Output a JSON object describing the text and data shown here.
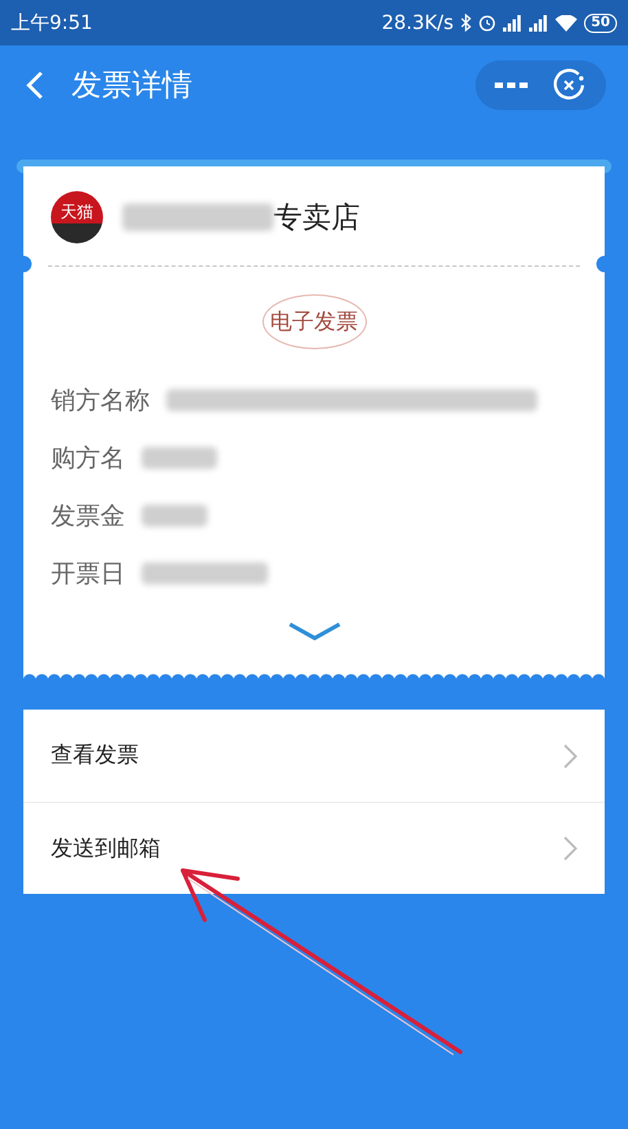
{
  "status_bar": {
    "time": "上午9:51",
    "speed": "28.3K/s",
    "battery": "50"
  },
  "header": {
    "title": "发票详情"
  },
  "invoice": {
    "shop_logo": "天猫",
    "shop_name": "专卖店",
    "stamp": "电子发票",
    "fields": [
      {
        "label": "销方名称"
      },
      {
        "label": "购方名"
      },
      {
        "label": "发票金"
      },
      {
        "label": "开票日"
      }
    ]
  },
  "actions": [
    {
      "label": "查看发票"
    },
    {
      "label": "发送到邮箱"
    }
  ],
  "annotation": {
    "kind": "arrow"
  }
}
